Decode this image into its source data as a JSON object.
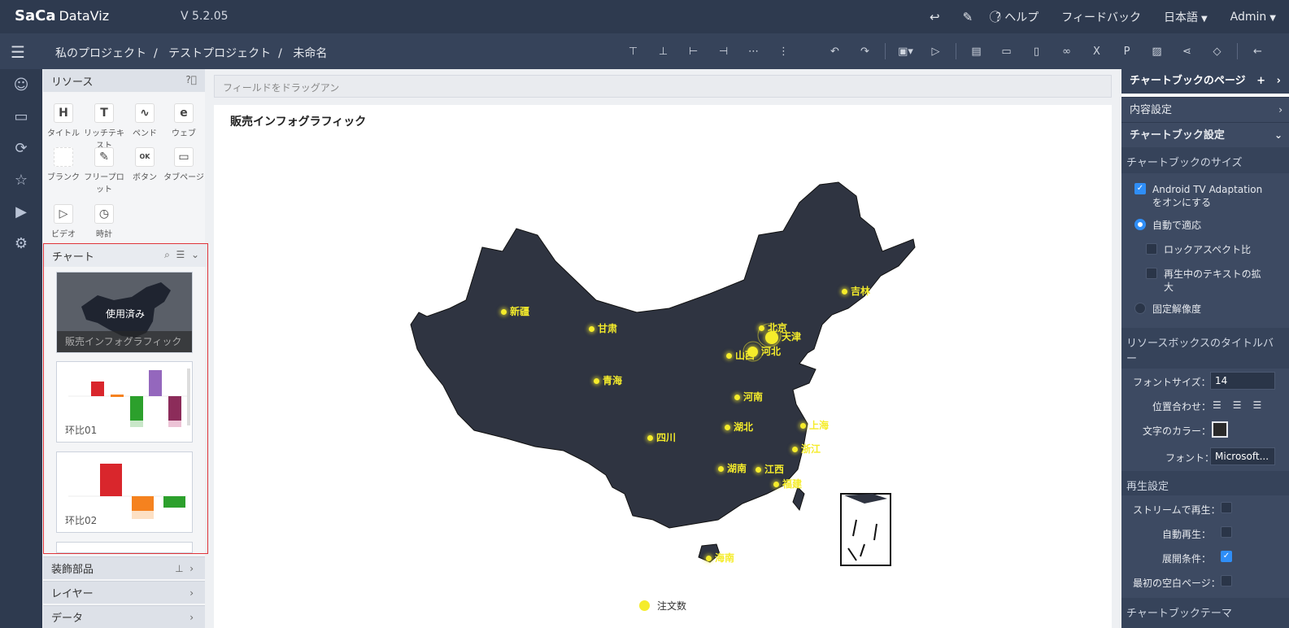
{
  "app": {
    "logo": "SaCa",
    "logo_sub": "DataViz",
    "version": "V 5.2.05"
  },
  "topbar": {
    "help": "ヘルプ",
    "feedback": "フィードバック",
    "language": "日本語",
    "user": "Admin"
  },
  "breadcrumb": [
    "私のプロジェクト",
    "テストプロジェクト",
    "未命名"
  ],
  "resources": {
    "title": "リソース",
    "items": [
      "タイトル",
      "リッチテキスト",
      "ペンド",
      "ウェブ",
      "ブランク",
      "フリープロット",
      "ボタン",
      "タブページ",
      "ビデオ",
      "時計"
    ]
  },
  "charts": {
    "title": "チャート",
    "used_label": "使用済み",
    "thumbs": [
      "販売インフォグラフィック",
      "环比01",
      "环比02"
    ]
  },
  "accordions": [
    "装飾部品",
    "レイヤー",
    "データ"
  ],
  "canvas": {
    "field_drop": "フィールドをドラッグアン",
    "title": "販売インフォグラフィック",
    "legend": "注文数"
  },
  "chart_data": {
    "type": "scatter",
    "title": "販売インフォグラフィック",
    "legend": [
      "注文数"
    ],
    "color": "#f5ec2b",
    "map": "China",
    "points": [
      "新疆",
      "甘肃",
      "青海",
      "吉林",
      "北京",
      "天津",
      "山西",
      "河北",
      "河南",
      "上海",
      "湖北",
      "四川",
      "浙江",
      "湖南",
      "江西",
      "福建",
      "海南"
    ]
  },
  "right_panel": {
    "page_title": "チャートブックのページ",
    "content_settings": "内容設定",
    "book_settings": "チャートブック設定",
    "book_size": "チャートブックのサイズ",
    "android_tv": "Android TV Adaptation をオンにする",
    "auto_fit": "自動で適応",
    "lock_aspect": "ロックアスペクト比",
    "enlarge_text": "再生中のテキストの拡大",
    "fixed_res": "固定解像度",
    "resbox_title": "リソースボックスのタイトルバー",
    "font_size_label": "フォントサイズ：",
    "font_size_value": "14",
    "align_label": "位置合わせ：",
    "text_color_label": "文字のカラー：",
    "font_label": "フォント：",
    "font_value": "Microsoft...",
    "playback": "再生設定",
    "stream": "ストリームで再生：",
    "autoplay": "自動再生：",
    "expand": "展開条件：",
    "first_blank": "最初の空白ページ：",
    "theme": "チャートブックテーマ"
  }
}
